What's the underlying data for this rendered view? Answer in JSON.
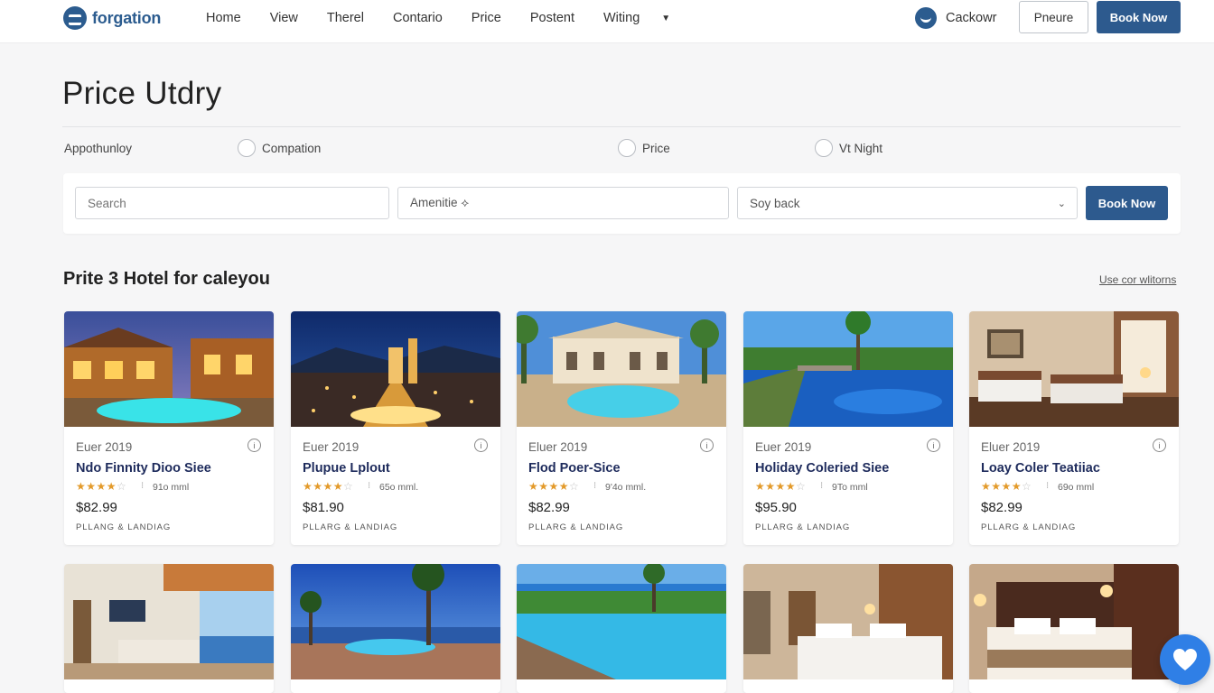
{
  "header": {
    "logo_text": "forgation",
    "nav": [
      "Home",
      "View",
      "Therel",
      "Contario",
      "Price",
      "Postent",
      "Witing"
    ],
    "user_name": "Cackowr",
    "outline_button": "Pneure",
    "book_button": "Book Now"
  },
  "page": {
    "title": "Price Utdry",
    "option_label": "Appothunloy",
    "options": [
      "Compation",
      "Price",
      "Vt Night"
    ]
  },
  "search": {
    "search_placeholder": "Search",
    "amenities_value": "Amenitie ⟡",
    "sort_value": "Soy back",
    "book_button": "Book Now"
  },
  "section": {
    "title": "Prite 3 Hotel for caleyou",
    "link": "Use cor wlitorns"
  },
  "hotels": [
    {
      "date": "Euer 2019",
      "name": "Ndo Finnity Dioo Siee",
      "stars": 4,
      "distance": "91o mml",
      "price": "$82.99",
      "tag": "PLLANG & LANDIAG"
    },
    {
      "date": "Euer 2019",
      "name": "Plupue Lplout",
      "stars": 4,
      "distance": "65o mml.",
      "price": "$81.90",
      "tag": "PLLARG & LANDIAG"
    },
    {
      "date": "Eluer 2019",
      "name": "Flod Poer-Sice",
      "stars": 4,
      "distance": "9'4o mml.",
      "price": "$82.99",
      "tag": "PLLARG & LANDIAG"
    },
    {
      "date": "Euer 2019",
      "name": "Holiday Coleried Siee",
      "stars": 4,
      "distance": "9To mml",
      "price": "$95.90",
      "tag": "PLLARG & LANDIAG"
    },
    {
      "date": "Eluer 2019",
      "name": "Loay Coler Teatiiac",
      "stars": 4,
      "distance": "69o mml",
      "price": "$82.99",
      "tag": "PLLARG & LANDIAG"
    }
  ],
  "icons": {
    "logo": "logo-icon",
    "user": "user-avatar-icon",
    "info": "info-icon",
    "fab": "heart-icon"
  },
  "colors": {
    "brand": "#2d5a8e",
    "accent_blue": "#2f7fe6",
    "star": "#e39a2a",
    "hotel_name": "#1e2b5c"
  }
}
